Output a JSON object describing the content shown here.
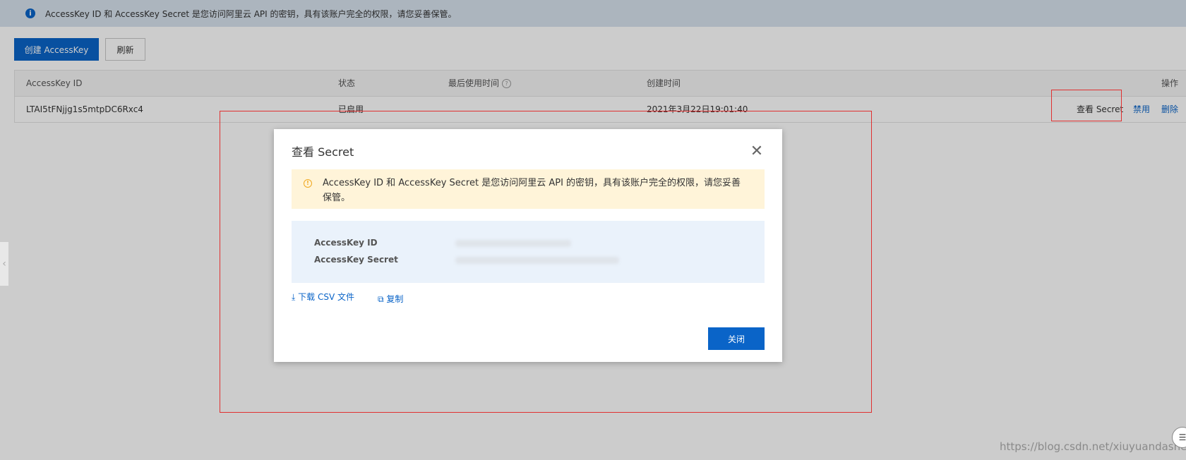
{
  "notice": {
    "text": "AccessKey ID 和 AccessKey Secret 是您访问阿里云 API 的密钥，具有该账户完全的权限，请您妥善保管。"
  },
  "toolbar": {
    "create_label": "创建 AccessKey",
    "refresh_label": "刷新"
  },
  "table": {
    "headers": {
      "id": "AccessKey ID",
      "status": "状态",
      "last_used": "最后使用时间",
      "created": "创建时间",
      "actions": "操作"
    },
    "rows": [
      {
        "id": "LTAI5tFNjjg1s5mtpDC6Rxc4",
        "status": "已启用",
        "last_used": "",
        "created": "2021年3月22日19:01:40",
        "actions": [
          "查看 Secret",
          "禁用",
          "删除"
        ]
      }
    ]
  },
  "dialog": {
    "title": "查看 Secret",
    "warning": "AccessKey ID 和 AccessKey Secret 是您访问阿里云 API 的密钥，具有该账户完全的权限，请您妥善保管。",
    "fields": [
      {
        "label": "AccessKey ID",
        "value": ""
      },
      {
        "label": "AccessKey Secret",
        "value": ""
      }
    ],
    "download_label": "下载 CSV 文件",
    "copy_label": "复制",
    "close_label": "关闭"
  },
  "watermark": "https://blog.csdn.net/xiuyuandashen",
  "colors": {
    "primary": "#0a64c8",
    "notice_bg": "#d8e3ee",
    "warning_bg": "#fff4d9",
    "keys_bg": "#eaf2fb",
    "annotation": "#e03030"
  }
}
